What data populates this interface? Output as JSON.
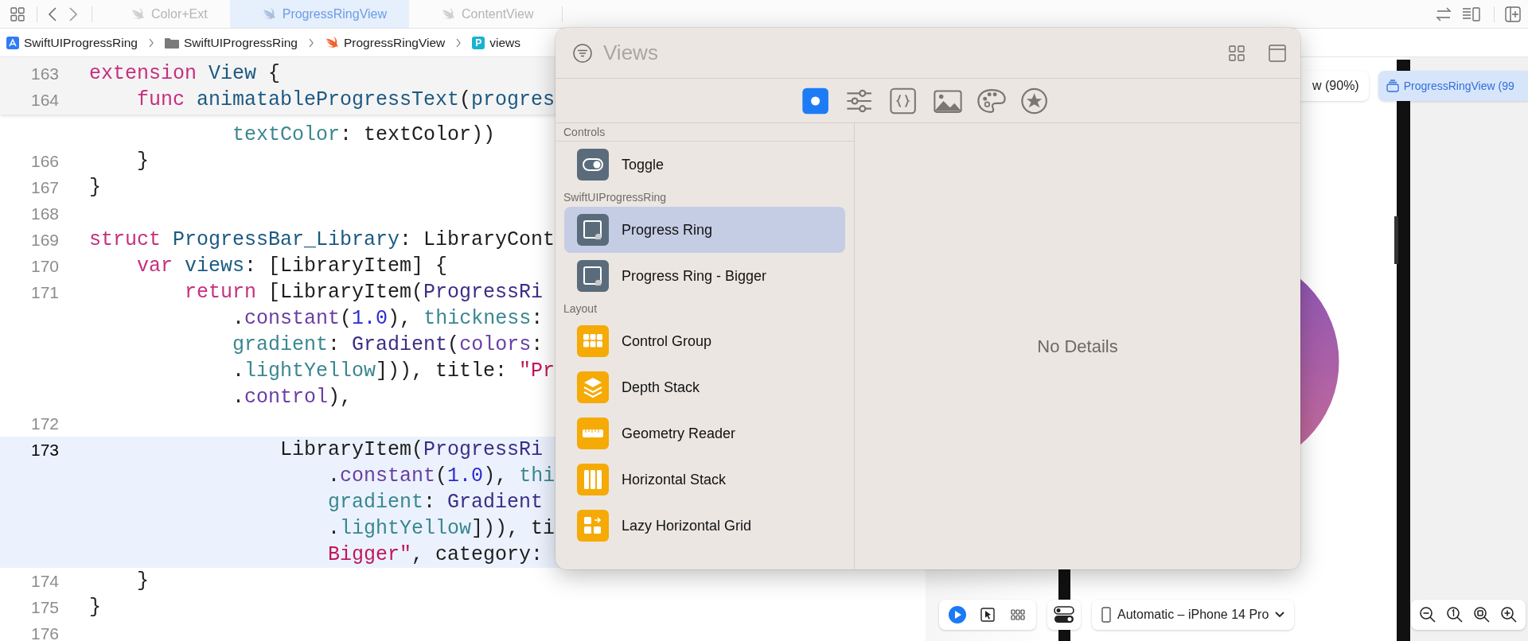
{
  "top_bar": {
    "tabs": [
      {
        "label": "Color+Ext",
        "selected": false
      },
      {
        "label": "ProgressRingView",
        "selected": true
      },
      {
        "label": "ContentView",
        "selected": false
      }
    ]
  },
  "breadcrumb": [
    {
      "label": "SwiftUIProgressRing",
      "kind": "app"
    },
    {
      "label": "SwiftUIProgressRing",
      "kind": "folder"
    },
    {
      "label": "ProgressRingView",
      "kind": "swift"
    },
    {
      "label": "views",
      "kind": "property",
      "icon_letter": "P"
    }
  ],
  "editor": {
    "sticky_lines": [
      {
        "number": "163",
        "highlighted": false,
        "rows": [
          {
            "segments": [
              {
                "text": "extension ",
                "kind": "kw"
              },
              {
                "text": "View",
                "kind": "decl"
              },
              {
                "text": " {",
                "kind": "plain"
              }
            ]
          }
        ]
      },
      {
        "number": "164",
        "highlighted": false,
        "rows": [
          {
            "segments": [
              {
                "text": "    func ",
                "kind": "kw"
              },
              {
                "text": "animatableProgressText",
                "kind": "decl"
              },
              {
                "text": "(",
                "kind": "plain"
              },
              {
                "text": "progres",
                "kind": "decl"
              }
            ]
          }
        ]
      }
    ],
    "lines": [
      {
        "highlighted": false,
        "rows": [
          {
            "segments": [
              {
                "text": "            textColor",
                "kind": "prop"
              },
              {
                "text": ": textColor))",
                "kind": "plain"
              }
            ]
          }
        ]
      },
      {
        "number": "166",
        "highlighted": false,
        "rows": [
          {
            "segments": [
              {
                "text": "    }",
                "kind": "plain"
              }
            ]
          }
        ]
      },
      {
        "number": "167",
        "highlighted": false,
        "rows": [
          {
            "segments": [
              {
                "text": "}",
                "kind": "plain"
              }
            ]
          }
        ]
      },
      {
        "number": "168",
        "highlighted": false
      },
      {
        "number": "169",
        "highlighted": false,
        "rows": [
          {
            "segments": [
              {
                "text": "struct ",
                "kind": "kw"
              },
              {
                "text": "ProgressBar_Library",
                "kind": "decl"
              },
              {
                "text": ": LibraryCont",
                "kind": "plain"
              }
            ]
          }
        ]
      },
      {
        "number": "170",
        "highlighted": false,
        "rows": [
          {
            "segments": [
              {
                "text": "    var ",
                "kind": "kw"
              },
              {
                "text": "views",
                "kind": "decl"
              },
              {
                "text": ": [LibraryItem] {",
                "kind": "plain"
              }
            ]
          }
        ]
      },
      {
        "number": "171",
        "highlighted": false,
        "rows": [
          {
            "segments": [
              {
                "text": "        return",
                "kind": "kw"
              },
              {
                "text": " [LibraryItem(",
                "kind": "plain"
              },
              {
                "text": "ProgressRi",
                "kind": "cls"
              }
            ]
          },
          {
            "segments": [
              {
                "text": "            .",
                "kind": "plain"
              },
              {
                "text": "constant",
                "kind": "call"
              },
              {
                "text": "(",
                "kind": "plain"
              },
              {
                "text": "1.0",
                "kind": "num"
              },
              {
                "text": "), ",
                "kind": "plain"
              },
              {
                "text": "thickness",
                "kind": "prop"
              },
              {
                "text": ":",
                "kind": "plain"
              }
            ]
          },
          {
            "segments": [
              {
                "text": "            gradient",
                "kind": "prop"
              },
              {
                "text": ": ",
                "kind": "plain"
              },
              {
                "text": "Gradient",
                "kind": "cls"
              },
              {
                "text": "(",
                "kind": "plain"
              },
              {
                "text": "colors",
                "kind": "call"
              },
              {
                "text": ":",
                "kind": "plain"
              }
            ]
          },
          {
            "segments": [
              {
                "text": "            .",
                "kind": "plain"
              },
              {
                "text": "lightYellow",
                "kind": "prop"
              },
              {
                "text": "])), title: ",
                "kind": "plain"
              },
              {
                "text": "\"Pr",
                "kind": "str"
              }
            ]
          },
          {
            "segments": [
              {
                "text": "            .",
                "kind": "plain"
              },
              {
                "text": "control",
                "kind": "call"
              },
              {
                "text": "),",
                "kind": "plain"
              }
            ]
          }
        ]
      },
      {
        "number": "172",
        "highlighted": false
      },
      {
        "number": "173",
        "highlighted": true,
        "rows": [
          {
            "segments": [
              {
                "text": "                LibraryItem(",
                "kind": "plain"
              },
              {
                "text": "ProgressRi",
                "kind": "cls"
              }
            ]
          },
          {
            "segments": [
              {
                "text": "                    .",
                "kind": "plain"
              },
              {
                "text": "constant",
                "kind": "call"
              },
              {
                "text": "(",
                "kind": "plain"
              },
              {
                "text": "1.0",
                "kind": "num"
              },
              {
                "text": "), ",
                "kind": "plain"
              },
              {
                "text": "thi",
                "kind": "prop"
              }
            ]
          },
          {
            "segments": [
              {
                "text": "                    gradient",
                "kind": "prop"
              },
              {
                "text": ": ",
                "kind": "plain"
              },
              {
                "text": "Gradient",
                "kind": "cls"
              }
            ]
          },
          {
            "segments": [
              {
                "text": "                    .",
                "kind": "plain"
              },
              {
                "text": "lightYellow",
                "kind": "prop"
              },
              {
                "text": "])), ti",
                "kind": "plain"
              }
            ]
          },
          {
            "segments": [
              {
                "text": "                    Bigger\"",
                "kind": "str"
              },
              {
                "text": ", category:",
                "kind": "plain"
              }
            ]
          }
        ]
      },
      {
        "number": "174",
        "highlighted": false,
        "rows": [
          {
            "segments": [
              {
                "text": "    }",
                "kind": "plain"
              }
            ]
          }
        ]
      },
      {
        "number": "175",
        "highlighted": false,
        "rows": [
          {
            "segments": [
              {
                "text": "}",
                "kind": "plain"
              }
            ]
          }
        ]
      },
      {
        "number": "176",
        "highlighted": false
      }
    ]
  },
  "library": {
    "placeholder": "Views",
    "tabs": [
      {
        "kind": "views",
        "selected": true
      },
      {
        "kind": "modifiers",
        "selected": false
      },
      {
        "kind": "snippets",
        "selected": false
      },
      {
        "kind": "media",
        "selected": false
      },
      {
        "kind": "colors",
        "selected": false
      },
      {
        "kind": "symbols",
        "selected": false
      }
    ],
    "sections": [
      {
        "title": "Controls",
        "items": [
          {
            "label": "Toggle",
            "kind": "toggle",
            "selected": false
          }
        ]
      },
      {
        "title": "SwiftUIProgressRing",
        "items": [
          {
            "label": "Progress Ring",
            "kind": "custom",
            "selected": true
          },
          {
            "label": "Progress Ring - Bigger",
            "kind": "custom",
            "selected": false
          }
        ]
      },
      {
        "title": "Layout",
        "items": [
          {
            "label": "Control Group",
            "kind": "control-group",
            "selected": false
          },
          {
            "label": "Depth Stack",
            "kind": "depth-stack",
            "selected": false
          },
          {
            "label": "Geometry Reader",
            "kind": "geometry",
            "selected": false
          },
          {
            "label": "Horizontal Stack",
            "kind": "hstack",
            "selected": false
          },
          {
            "label": "Lazy Horizontal Grid",
            "kind": "lazy-grid",
            "selected": false
          }
        ]
      }
    ],
    "detail": "No Details"
  },
  "preview": {
    "pills": [
      {
        "label": "w (90%)",
        "selected": false
      },
      {
        "label": "ProgressRingView (99",
        "selected": true
      }
    ],
    "device_picker": "Automatic – iPhone 14 Pro"
  }
}
